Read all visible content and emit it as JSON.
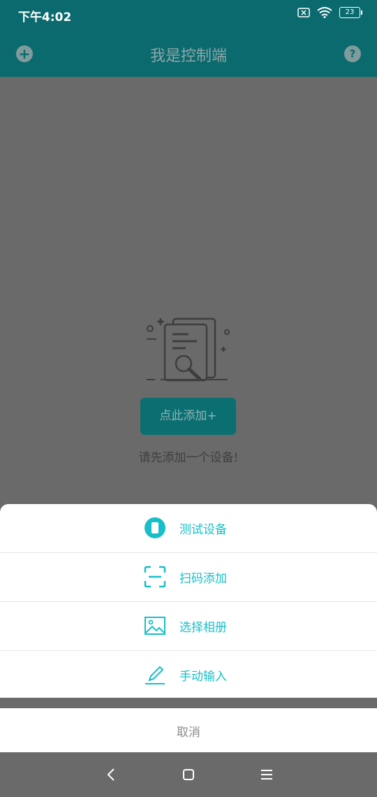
{
  "status_bar": {
    "time": "下午4:02",
    "battery": "23"
  },
  "header": {
    "title": "我是控制端"
  },
  "empty_state": {
    "add_button": "点此添加+",
    "hint": "请先添加一个设备!"
  },
  "sheet": {
    "items": [
      {
        "label": "测试设备",
        "icon": "phone-icon"
      },
      {
        "label": "扫码添加",
        "icon": "scan-icon"
      },
      {
        "label": "选择相册",
        "icon": "image-icon"
      },
      {
        "label": "手动输入",
        "icon": "pencil-icon"
      }
    ],
    "cancel": "取消"
  },
  "colors": {
    "accent": "#18bfc8",
    "header": "#0a6a6e",
    "overlay": "#6a6a6a"
  }
}
